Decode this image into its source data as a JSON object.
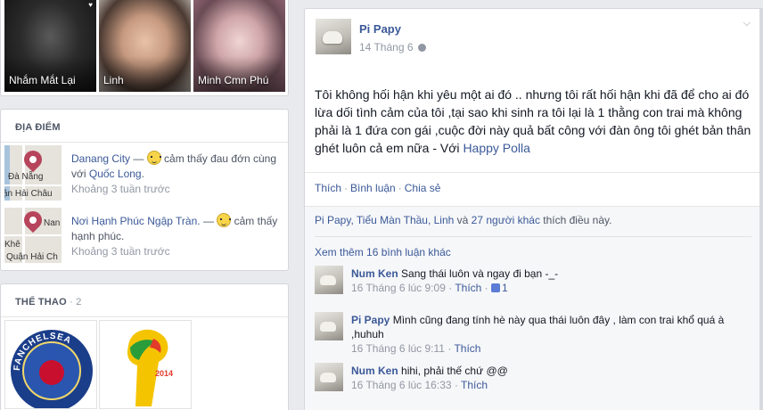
{
  "friends": [
    {
      "name": "Nhắm Mắt Lại",
      "heart": "♥"
    },
    {
      "name": "Linh"
    },
    {
      "name": "Minh Cmn Phú"
    }
  ],
  "places": {
    "title": "ĐỊA ĐIỂM",
    "items": [
      {
        "place": "Danang City",
        "sep": " — ",
        "feeling": " cảm thấy đau đớn cùng với ",
        "with": "Quốc Long",
        "end": ".",
        "time": "Khoảng 3 tuần trước",
        "map_labels": [
          "Đà Nẵng",
          "ận Hải Châu"
        ]
      },
      {
        "place": "Nơi Hạnh Phúc Ngập Tràn.",
        "sep": " — ",
        "feeling": " cảm thấy hạnh phúc.",
        "time": "Khoảng 3 tuần trước",
        "map_labels": [
          "Nan",
          "Khê",
          "Quận Hải Ch"
        ]
      }
    ]
  },
  "sports": {
    "title": "THỂ THAO",
    "count": " · 2",
    "logos": [
      "FANCHELSEA",
      "2014"
    ]
  },
  "post": {
    "author": "Pi Papy",
    "time": "14 Tháng 6",
    "body": "Tôi không hối hận khi yêu một ai đó .. nhưng tôi rất hối hận khi đã để cho ai đó lừa dối tình cảm của tôi ,tại sao khi sinh ra tôi lại là 1 thằng con trai mà không phải là 1 đứa con gái ,cuộc đời này quả bất công với đàn ông tôi ghét bản thân ghét luôn cả em nữa",
    "with_prefix": " - Với ",
    "with_name": "Happy Polla",
    "actions": [
      "Thích",
      "Bình luận",
      "Chia sẻ"
    ],
    "likes_names": "Pi Papy, Tiểu Màn Thầu, Linh",
    "likes_and": " và ",
    "likes_others": "27 người khác",
    "likes_suffix": " thích điều này.",
    "more_comments": "Xem thêm 16 bình luận khác",
    "comments": [
      {
        "name": "Num Ken",
        "text": "Sang thái luôn và ngay đi bạn -_-",
        "time": "16 Tháng 6 lúc 9:09",
        "like": "Thích",
        "like_count": "1"
      },
      {
        "name": "Pi Papy",
        "text": "Mình cũng đang tính hè này qua thái luôn đây , làm con trai khổ quá à ,huhuh",
        "time": "16 Tháng 6 lúc 9:11",
        "like": "Thích"
      },
      {
        "name": "Num Ken",
        "text": "hihi, phải thế chứ @@",
        "time": "16 Tháng 6 lúc 16:33",
        "like": "Thích"
      }
    ]
  }
}
